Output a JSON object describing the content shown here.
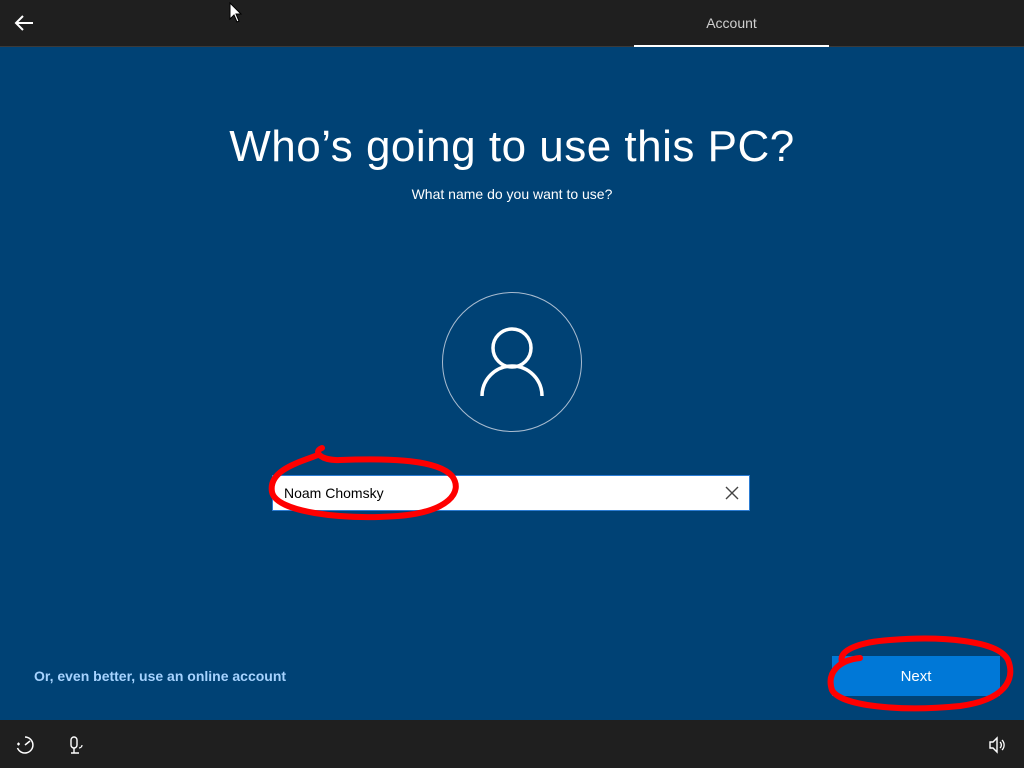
{
  "topbar": {
    "active_tab": "Account"
  },
  "main": {
    "title": "Who’s going to use this PC?",
    "subtitle": "What name do you want to use?",
    "name_field": {
      "value": "Noam Chomsky"
    },
    "online_account_link": "Or, even better, use an online account",
    "next_label": "Next"
  },
  "icons": {
    "back": "back-arrow-icon",
    "avatar": "user-icon",
    "clear": "close-icon",
    "ease_of_access": "ease-of-access-icon",
    "microphone": "microphone-icon",
    "volume": "volume-icon"
  },
  "colors": {
    "background": "#004275",
    "bar": "#1f1f1f",
    "accent": "#0078d7",
    "link": "#a6d3ff",
    "annotation": "#ff0000"
  }
}
